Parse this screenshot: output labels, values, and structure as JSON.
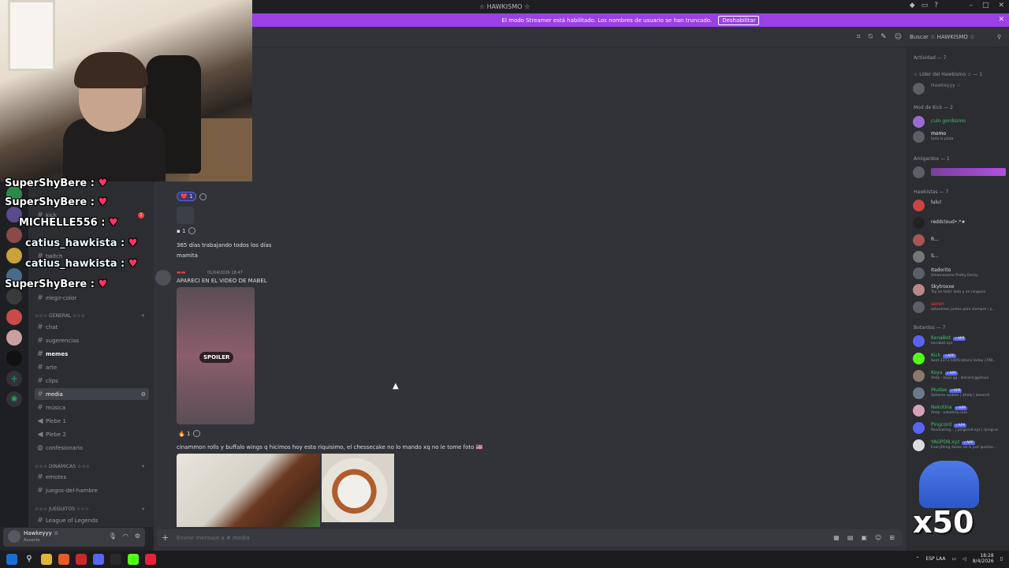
{
  "window": {
    "title": "☆ HAWKISMO ☆"
  },
  "streamer_banner": {
    "text": "El modo Streamer está habilitado. Los nombres de usuario se han truncado.",
    "button": "Deshabilitar"
  },
  "header": {
    "search_placeholder": "Buscar ☆ HAWKISMO ☆"
  },
  "overlay_chat": [
    {
      "user": "SuperShyBere",
      "msg": "♥"
    },
    {
      "user": "SuperShyBere",
      "msg": "♥"
    },
    {
      "user": "MICHELLE556",
      "msg": "♥"
    },
    {
      "user": "catius_hawkista",
      "msg": "♥"
    },
    {
      "user": "catius_hawkista",
      "msg": "♥"
    },
    {
      "user": "SuperShyBere",
      "msg": "♥"
    }
  ],
  "sidebar": {
    "channels_top": [
      {
        "label": "kick"
      },
      {
        "label": "twitch"
      },
      {
        "label": "elegir-color"
      }
    ],
    "general_category": "☆☆☆ GENERAL ☆☆☆",
    "general_channels": [
      {
        "label": "chat"
      },
      {
        "label": "sugerencias"
      },
      {
        "label": "memes"
      },
      {
        "label": "arte"
      },
      {
        "label": "clips"
      },
      {
        "label": "media"
      },
      {
        "label": "música"
      },
      {
        "label": "Plebe 1"
      },
      {
        "label": "Plebe 2"
      },
      {
        "label": "confesionario"
      }
    ],
    "dinamicas_category": "☆☆☆ DINÁMICAS ☆☆☆",
    "dinamicas_channels": [
      {
        "label": "emotes"
      },
      {
        "label": "juegos-del-hambre"
      }
    ],
    "juegos_category": "☆☆☆ JUEGUITOS ☆☆☆",
    "juegos_channels": [
      {
        "label": "League of Legends"
      }
    ]
  },
  "user_panel": {
    "name": "Hawkeyyy ☆",
    "status": "Ausente"
  },
  "chat": {
    "reaction_1": {
      "emoji": "❤️",
      "count": "1"
    },
    "reaction_2": {
      "count": "1"
    },
    "message_1": "365 días trabajando todos los días mamita",
    "message_2_time": "01/04/2026 18:47",
    "message_2": "APARECI EN EL VIDEO DE MABEL",
    "spoiler_label": "SPOILER",
    "reaction_3": {
      "emoji": "🔥",
      "count": "1"
    },
    "message_3": "cinammon rolls y  buffalo wings q hicimos hoy esta riquisimo, el chessecake no lo mando xq no le tome foto 🇺🇸"
  },
  "composer": {
    "placeholder": "Enviar mensaje a #",
    "channel": "media"
  },
  "members": {
    "activity": "Actividad — 7",
    "lider_category": "☆ Líder del Hawkismo ☆ — 1",
    "lider": [
      {
        "name": "Hawkeyyy ☆"
      }
    ],
    "mod_category": "Mod de Kick — 2",
    "mods": [
      {
        "name": "culo gordisimo",
        "sub": ""
      },
      {
        "name": "momo",
        "sub": "toda la plata"
      }
    ],
    "amigardos_category": "Amigardos — 1",
    "hawkistas_category": "Hawkistas — 7",
    "hawkistas": [
      {
        "name": "lulu!",
        "sub": ""
      },
      {
        "name": "reddcloud•.*★",
        "sub": ""
      },
      {
        "name": "R...",
        "sub": ""
      },
      {
        "name": "S...",
        "sub": ""
      },
      {
        "name": "Itadorito",
        "sub": "Umamasame Pretty Derby"
      },
      {
        "name": "Skytroxxe",
        "sub": "Toy en todo' lado y en ninguno"
      },
      {
        "name": "seren",
        "sub": "estaremos juntos para siempre / y..."
      }
    ],
    "bots_category": "Botardos — 7",
    "bots": [
      {
        "name": "KenaBot",
        "sub": "kenabot.xyz"
      },
      {
        "name": "Kick",
        "sub": "Sent 2373 notifications today (799..."
      },
      {
        "name": "Koya",
        "sub": "/help · koya.gg · discord.gg/koya"
      },
      {
        "name": "Mudae",
        "sub": "Spheres update | $help | $search"
      },
      {
        "name": "Nekotina",
        "sub": "/help · nekotina.com"
      },
      {
        "name": "Pingcord",
        "sub": "Recovering... | pingcord.xyz | /pingcor"
      },
      {
        "name": "YAGPDB.xyz",
        "sub": "Everything dunks do is just quacke..."
      }
    ],
    "app_badge": "✓APP"
  },
  "sticker": {
    "text": "x50"
  },
  "taskbar": {
    "lang": "ESP LAA",
    "time": "18:28",
    "date": "8/4/2026"
  }
}
